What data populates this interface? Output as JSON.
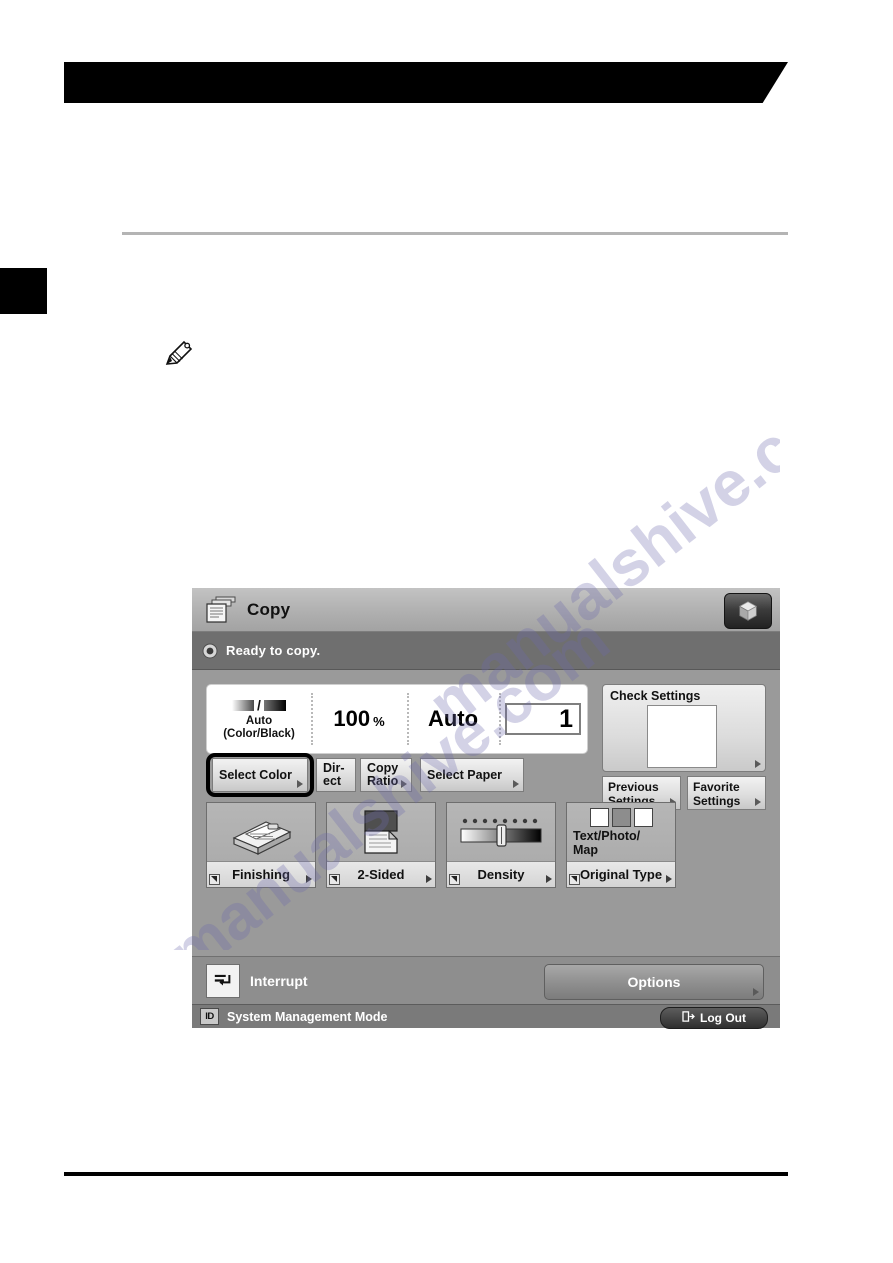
{
  "page": {
    "header_title": "",
    "side_tab_label": "",
    "note_icon": "pencil-note-icon"
  },
  "watermark": {
    "line_a": "manualshive.com",
    "line_b": "manualshive.com"
  },
  "lcd": {
    "titlebar": {
      "title": "Copy",
      "doc_icon": "copy-documents-icon",
      "cube_icon": "cube-icon"
    },
    "status": {
      "icon": "status-ready-icon",
      "text": "Ready to copy."
    },
    "readout": {
      "color_mode": {
        "icon": "color-black-gradient-icon",
        "line1": "Auto",
        "line2": "(Color/Black)"
      },
      "copy_ratio": {
        "value": "100",
        "unit": "%"
      },
      "paper": {
        "value": "Auto"
      },
      "copy_count": {
        "value": "1"
      }
    },
    "tab_buttons": [
      {
        "label": "Select Color",
        "name": "select-color-button",
        "highlighted": true
      },
      {
        "label": "Dir-\nect",
        "name": "direct-button",
        "highlighted": false
      },
      {
        "label": "Copy\nRatio",
        "name": "copy-ratio-button",
        "highlighted": false
      },
      {
        "label": "Select Paper",
        "name": "select-paper-button",
        "highlighted": false
      }
    ],
    "tab_labels": {
      "select_color": "Select Color",
      "direct_l1": "Dir-",
      "direct_l2": "ect",
      "ratio_l1": "Copy",
      "ratio_l2": "Ratio",
      "select_paper": "Select Paper"
    },
    "check_settings": {
      "title": "Check Settings",
      "preview_icon": "settings-preview-icon"
    },
    "side_buttons": {
      "previous_l1": "Previous",
      "previous_l2": "Settings",
      "favorite_l1": "Favorite",
      "favorite_l2": "Settings"
    },
    "function_buttons": [
      {
        "label": "Finishing",
        "icon": "finishing-stack-icon",
        "value": ""
      },
      {
        "label": "2-Sided",
        "icon": "two-sided-page-icon",
        "value": ""
      },
      {
        "label": "Density",
        "icon": "density-slider-icon",
        "value": ""
      },
      {
        "label": "Original Type",
        "icon": "original-type-icon",
        "value_l1": "Text/Photo/",
        "value_l2": "Map"
      }
    ],
    "action_bar": {
      "interrupt_icon": "interrupt-icon",
      "interrupt_label": "Interrupt",
      "options_label": "Options"
    },
    "footer": {
      "id_badge": "ID",
      "mode_text": "System Management Mode",
      "logout_icon": "logout-icon",
      "logout_label": "Log Out"
    }
  },
  "colors": {
    "panel_bg": "#9a9a9a",
    "titlebar": "#b0b0b0",
    "status_strip": "#6f6f6f",
    "accent_black": "#000000",
    "button_face": "#dedede",
    "footer_bar": "#7a7a7a"
  }
}
